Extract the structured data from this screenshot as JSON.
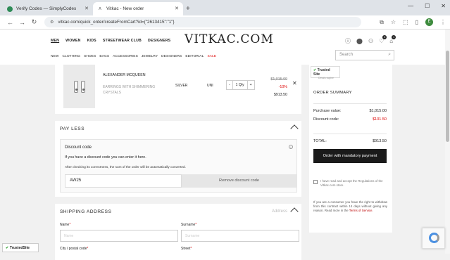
{
  "browser": {
    "tabs": [
      {
        "title": "Verify Codes — SimplyCodes",
        "active": false
      },
      {
        "title": "Vitkac - New order",
        "active": true
      }
    ],
    "url": "vitkac.com/quick_order/createFromCart?id={\"2613415\":\"1\"}",
    "profile_initial": "E"
  },
  "header": {
    "gender_nav": [
      "MEN",
      "WOMEN",
      "KIDS",
      "STREETWEAR CLUB",
      "DESIGNERS"
    ],
    "logo": "VITKAC.COM",
    "categories": [
      "NEW",
      "CLOTHING",
      "SHOES",
      "BAGS",
      "ACCESSORIES",
      "JEWELRY",
      "DESIGNERS",
      "EDITORIAL",
      "SALE"
    ],
    "search_placeholder": "Search",
    "wishlist_count": "0",
    "cart_count": "1"
  },
  "product": {
    "brand": "ALEXANDER MCQUEEN",
    "name": "EARRINGS WITH SHIMMERING CRYSTALS",
    "color": "SILVER",
    "size": "UNI",
    "qty_minus": "-",
    "qty": "1 Qty",
    "qty_plus": "+",
    "old_price": "$1,015.00",
    "discount_pct": "-10%",
    "price": "$913.50"
  },
  "pay_less": {
    "title": "PAY LESS",
    "discount_title": "Discount code",
    "info_icon": "i",
    "text1": "If you have a discount code you can enter it here.",
    "text2": "After checking its correctness, the sum of the order will be automatically converted.",
    "code_value": "AW25",
    "remove_label": "Remove discount code"
  },
  "shipping": {
    "title": "SHIPPING ADDRESS",
    "address_link": "Address",
    "name_label": "Name",
    "name_placeholder": "Name",
    "surname_label": "Surname",
    "surname_placeholder": "Surname",
    "city_label": "City / postal code",
    "street_label": "Street",
    "required_mark": "*"
  },
  "summary": {
    "trusted_title": "Trusted Site",
    "trusted_sub": "Details tagline",
    "title": "ORDER SUMMARY",
    "purchase_label": "Purchase value:",
    "purchase_value": "$1,015.00",
    "discount_label": "Discount code:",
    "discount_value": "$101.50",
    "total_label": "TOTAL:",
    "total_value": "$913.50",
    "order_button": "Order with mandatory payment",
    "accept_text": "I have read and accept the Regulations of the Vitkac.com store.",
    "withdraw_text": "If you are a consumer you have the right to withdraw from this contract within 14 days without giving any reason. Read more in the",
    "terms_link": "Terms of Service."
  },
  "floating": {
    "trusted_site": "TrustedSite"
  },
  "colors": {
    "accent_red": "#d00000",
    "button_dark": "#1a1a1a",
    "trusted_green": "#2a9d2a"
  }
}
